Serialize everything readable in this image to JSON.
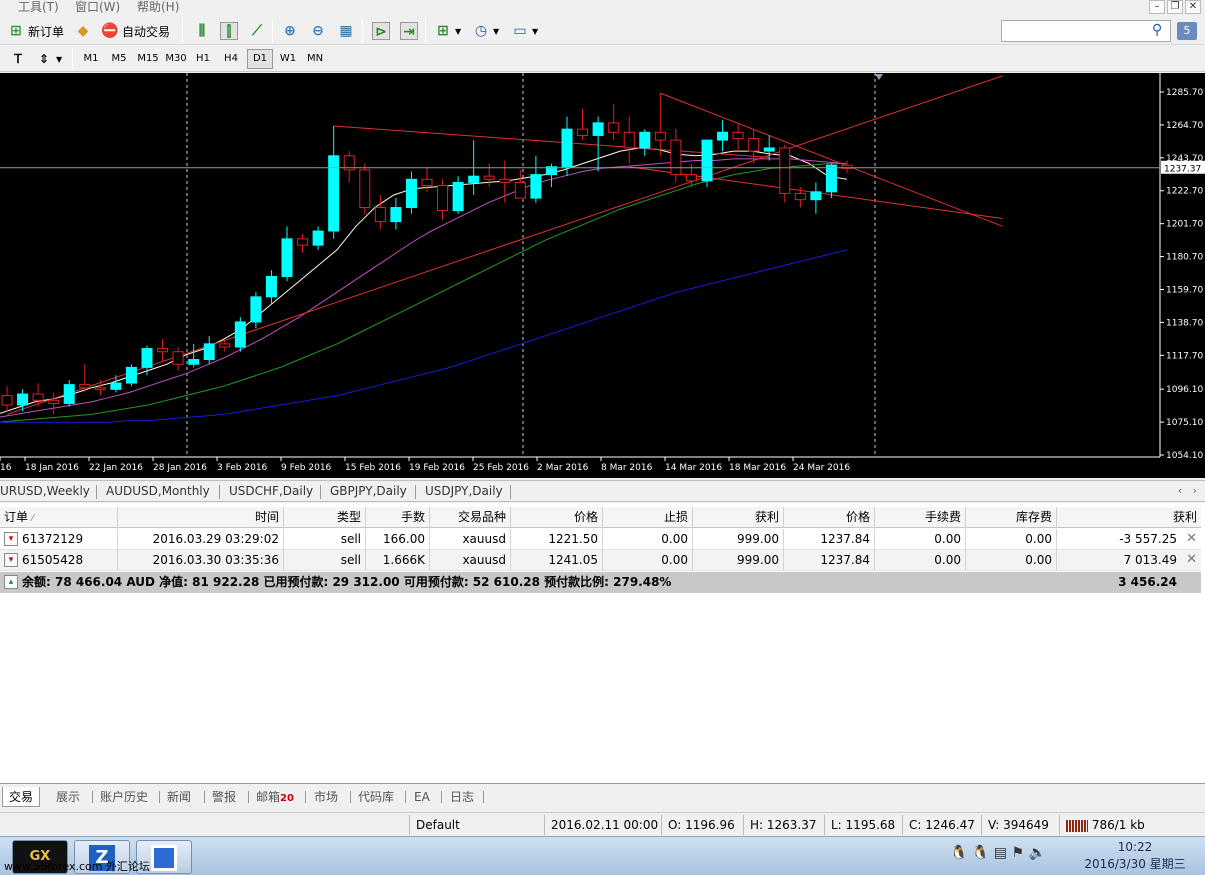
{
  "menu": {
    "items": [
      "工具(T)",
      "窗口(W)",
      "帮助(H)"
    ]
  },
  "toolbar": {
    "new_order": "新订单",
    "auto_trade": "自动交易",
    "search_placeholder": "",
    "notification_count": "5"
  },
  "timeframes": [
    "M1",
    "M5",
    "M15",
    "M30",
    "H1",
    "H4",
    "D1",
    "W1",
    "MN"
  ],
  "active_timeframe": "D1",
  "chart_data": {
    "type": "candlestick",
    "symbol": "XAUUSD",
    "timeframe": "D1",
    "background": "#000000",
    "price_axis_ticks": [
      1285.7,
      1264.7,
      1243.7,
      1222.7,
      1201.7,
      1180.7,
      1159.7,
      1138.7,
      1117.7,
      1096.1,
      1075.1,
      1054.1
    ],
    "current_price_label": "1237.37",
    "date_labels": [
      "16",
      "18 Jan 2016",
      "22 Jan 2016",
      "28 Jan 2016",
      "3 Feb 2016",
      "9 Feb 2016",
      "15 Feb 2016",
      "19 Feb 2016",
      "25 Feb 2016",
      "2 Mar 2016",
      "8 Mar 2016",
      "14 Mar 2016",
      "18 Mar 2016",
      "24 Mar 2016"
    ],
    "ylim": [
      1054.1,
      1285.7
    ],
    "bull_color": "#00ffff",
    "bear_color": "#e02020",
    "candles": [
      {
        "o": 1092,
        "h": 1098,
        "l": 1082,
        "c": 1086
      },
      {
        "o": 1086,
        "h": 1096,
        "l": 1082,
        "c": 1093
      },
      {
        "o": 1093,
        "h": 1100,
        "l": 1085,
        "c": 1089
      },
      {
        "o": 1089,
        "h": 1094,
        "l": 1080,
        "c": 1087
      },
      {
        "o": 1087,
        "h": 1102,
        "l": 1085,
        "c": 1099
      },
      {
        "o": 1099,
        "h": 1112,
        "l": 1094,
        "c": 1097
      },
      {
        "o": 1097,
        "h": 1102,
        "l": 1092,
        "c": 1096
      },
      {
        "o": 1096,
        "h": 1105,
        "l": 1094,
        "c": 1100
      },
      {
        "o": 1100,
        "h": 1112,
        "l": 1098,
        "c": 1110
      },
      {
        "o": 1110,
        "h": 1124,
        "l": 1105,
        "c": 1122
      },
      {
        "o": 1122,
        "h": 1128,
        "l": 1114,
        "c": 1120
      },
      {
        "o": 1120,
        "h": 1123,
        "l": 1108,
        "c": 1112
      },
      {
        "o": 1112,
        "h": 1125,
        "l": 1110,
        "c": 1115
      },
      {
        "o": 1115,
        "h": 1130,
        "l": 1112,
        "c": 1125
      },
      {
        "o": 1125,
        "h": 1127,
        "l": 1120,
        "c": 1123
      },
      {
        "o": 1123,
        "h": 1142,
        "l": 1120,
        "c": 1139
      },
      {
        "o": 1139,
        "h": 1158,
        "l": 1135,
        "c": 1155
      },
      {
        "o": 1155,
        "h": 1172,
        "l": 1150,
        "c": 1168
      },
      {
        "o": 1168,
        "h": 1200,
        "l": 1165,
        "c": 1192
      },
      {
        "o": 1192,
        "h": 1195,
        "l": 1183,
        "c": 1188
      },
      {
        "o": 1188,
        "h": 1200,
        "l": 1185,
        "c": 1197
      },
      {
        "o": 1197,
        "h": 1264,
        "l": 1192,
        "c": 1245
      },
      {
        "o": 1245,
        "h": 1248,
        "l": 1228,
        "c": 1236
      },
      {
        "o": 1236,
        "h": 1240,
        "l": 1208,
        "c": 1212
      },
      {
        "o": 1212,
        "h": 1220,
        "l": 1198,
        "c": 1203
      },
      {
        "o": 1203,
        "h": 1218,
        "l": 1198,
        "c": 1212
      },
      {
        "o": 1212,
        "h": 1235,
        "l": 1208,
        "c": 1230
      },
      {
        "o": 1230,
        "h": 1238,
        "l": 1222,
        "c": 1226
      },
      {
        "o": 1226,
        "h": 1230,
        "l": 1204,
        "c": 1210
      },
      {
        "o": 1210,
        "h": 1232,
        "l": 1208,
        "c": 1228
      },
      {
        "o": 1228,
        "h": 1255,
        "l": 1220,
        "c": 1232
      },
      {
        "o": 1232,
        "h": 1240,
        "l": 1225,
        "c": 1230
      },
      {
        "o": 1230,
        "h": 1242,
        "l": 1215,
        "c": 1228
      },
      {
        "o": 1228,
        "h": 1236,
        "l": 1218,
        "c": 1218
      },
      {
        "o": 1218,
        "h": 1245,
        "l": 1215,
        "c": 1233
      },
      {
        "o": 1233,
        "h": 1240,
        "l": 1225,
        "c": 1238
      },
      {
        "o": 1238,
        "h": 1270,
        "l": 1232,
        "c": 1262
      },
      {
        "o": 1262,
        "h": 1275,
        "l": 1255,
        "c": 1258
      },
      {
        "o": 1258,
        "h": 1270,
        "l": 1235,
        "c": 1266
      },
      {
        "o": 1266,
        "h": 1278,
        "l": 1255,
        "c": 1260
      },
      {
        "o": 1260,
        "h": 1270,
        "l": 1240,
        "c": 1250
      },
      {
        "o": 1250,
        "h": 1262,
        "l": 1245,
        "c": 1260
      },
      {
        "o": 1260,
        "h": 1285,
        "l": 1245,
        "c": 1255
      },
      {
        "o": 1255,
        "h": 1262,
        "l": 1228,
        "c": 1233
      },
      {
        "o": 1233,
        "h": 1240,
        "l": 1225,
        "c": 1229
      },
      {
        "o": 1229,
        "h": 1250,
        "l": 1225,
        "c": 1255
      },
      {
        "o": 1255,
        "h": 1268,
        "l": 1248,
        "c": 1260
      },
      {
        "o": 1260,
        "h": 1266,
        "l": 1248,
        "c": 1256
      },
      {
        "o": 1256,
        "h": 1262,
        "l": 1240,
        "c": 1248
      },
      {
        "o": 1248,
        "h": 1258,
        "l": 1242,
        "c": 1250
      },
      {
        "o": 1250,
        "h": 1252,
        "l": 1215,
        "c": 1221
      },
      {
        "o": 1221,
        "h": 1225,
        "l": 1212,
        "c": 1217
      },
      {
        "o": 1217,
        "h": 1228,
        "l": 1208,
        "c": 1222
      },
      {
        "o": 1222,
        "h": 1240,
        "l": 1218,
        "c": 1239
      },
      {
        "o": 1239,
        "h": 1242,
        "l": 1234,
        "c": 1237
      }
    ],
    "moving_averages": [
      {
        "color": "#ffffe0",
        "values": [
          1080,
          1084,
          1088,
          1090,
          1093,
          1097,
          1100,
          1104,
          1108,
          1112,
          1118,
          1122,
          1128,
          1135,
          1145,
          1155,
          1165,
          1175,
          1185,
          1200,
          1212,
          1220,
          1224,
          1225,
          1226,
          1227,
          1228,
          1229,
          1231,
          1233,
          1236,
          1240,
          1244,
          1248,
          1250,
          1249,
          1246,
          1245,
          1246,
          1248,
          1248,
          1246,
          1245,
          1240,
          1232,
          1230
        ]
      },
      {
        "color": "#c050c0",
        "values": [
          1078,
          1080,
          1082,
          1084,
          1086,
          1088,
          1091,
          1094,
          1098,
          1102,
          1106,
          1111,
          1116,
          1122,
          1128,
          1135,
          1142,
          1150,
          1158,
          1166,
          1174,
          1182,
          1190,
          1197,
          1203,
          1209,
          1215,
          1220,
          1225,
          1229,
          1232,
          1235,
          1237,
          1238,
          1239,
          1240,
          1241,
          1242,
          1242,
          1243,
          1243,
          1243,
          1243,
          1242,
          1241,
          1240
        ]
      },
      {
        "color": "#1e9e1e",
        "values": [
          1075,
          1076,
          1077,
          1078,
          1079,
          1080,
          1082,
          1084,
          1086,
          1089,
          1092,
          1095,
          1098,
          1102,
          1106,
          1110,
          1115,
          1120,
          1125,
          1131,
          1137,
          1143,
          1149,
          1155,
          1161,
          1167,
          1173,
          1179,
          1185,
          1191,
          1196,
          1201,
          1206,
          1211,
          1215,
          1219,
          1223,
          1227,
          1230,
          1233,
          1235,
          1237,
          1238,
          1239,
          1240,
          1240
        ]
      },
      {
        "color": "#1a1ae0",
        "values": [
          1075,
          1075,
          1075,
          1075,
          1075,
          1075,
          1075,
          1076,
          1076,
          1077,
          1078,
          1079,
          1080,
          1082,
          1084,
          1086,
          1088,
          1090,
          1092,
          1095,
          1098,
          1101,
          1104,
          1107,
          1110,
          1114,
          1118,
          1122,
          1126,
          1130,
          1134,
          1138,
          1142,
          1146,
          1150,
          1154,
          1158,
          1161,
          1164,
          1167,
          1170,
          1173,
          1176,
          1179,
          1182,
          1185
        ]
      }
    ],
    "trendline_color": "#e03030",
    "crosshair_price": 1237.37
  },
  "chart_tabs": [
    "URUSD,Weekly",
    "AUDUSD,Monthly",
    "USDCHF,Daily",
    "GBPJPY,Daily",
    "USDJPY,Daily"
  ],
  "trade_table": {
    "columns": [
      "订单",
      "时间",
      "类型",
      "手数",
      "交易品种",
      "价格",
      "止损",
      "获利",
      "价格",
      "手续费",
      "库存费",
      "获利"
    ],
    "rows": [
      [
        "61372129",
        "2016.03.29 03:29:02",
        "sell",
        "166.00",
        "xauusd",
        "1221.50",
        "0.00",
        "999.00",
        "1237.84",
        "0.00",
        "0.00",
        "-3 557.25"
      ],
      [
        "61505428",
        "2016.03.30 03:35:36",
        "sell",
        "1.666K",
        "xauusd",
        "1241.05",
        "0.00",
        "999.00",
        "1237.84",
        "0.00",
        "0.00",
        "7 013.49"
      ]
    ],
    "summary": "余额: 78 466.04 AUD  净值: 81 922.28  已用预付款: 29 312.00  可用预付款: 52 610.28  预付款比例: 279.48%",
    "total_profit": "3 456.24"
  },
  "bottom_tabs": [
    "交易",
    "展示",
    "账户历史",
    "新闻",
    "警报",
    "邮箱",
    "市场",
    "代码库",
    "EA",
    "日志"
  ],
  "mail_count": "20",
  "statusbar": {
    "profile": "Default",
    "datetime": "2016.02.11 00:00",
    "open": "O: 1196.96",
    "high": "H: 1263.37",
    "low": "L: 1195.68",
    "close": "C: 1246.47",
    "volume": "V: 394649",
    "connection": "786/1 kb"
  },
  "taskbar": {
    "watermark": "www.55forex.com 外汇论坛",
    "clock_time": "10:22",
    "clock_date": "2016/3/30 星期三"
  }
}
